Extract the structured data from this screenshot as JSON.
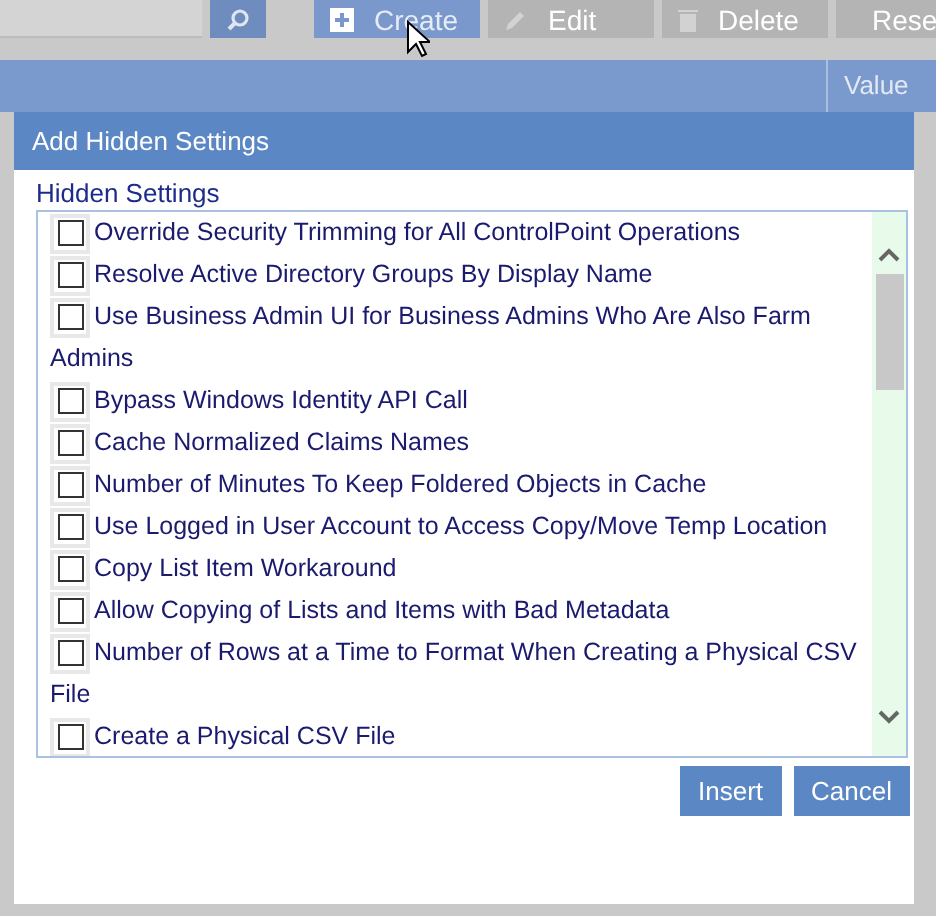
{
  "toolbar": {
    "buttons": [
      {
        "kind": "create",
        "label": "Create",
        "disabled": false
      },
      {
        "kind": "edit",
        "label": "Edit",
        "disabled": true
      },
      {
        "kind": "delete",
        "label": "Delete",
        "disabled": true
      },
      {
        "kind": "reset",
        "label": "Rese",
        "disabled": true
      }
    ]
  },
  "table": {
    "columns": [
      "Value"
    ]
  },
  "dialog": {
    "title": "Add Hidden Settings",
    "list_label": "Hidden Settings",
    "settings": [
      {
        "label": "Override Security Trimming for All ControlPoint Operations",
        "checked": false
      },
      {
        "label": "Resolve Active Directory Groups By Display Name",
        "checked": false
      },
      {
        "label": "Use Business Admin UI for Business Admins Who Are Also Farm Admins",
        "checked": false
      },
      {
        "label": "Bypass Windows Identity API Call",
        "checked": false
      },
      {
        "label": "Cache Normalized Claims Names",
        "checked": false
      },
      {
        "label": "Number of Minutes To Keep Foldered Objects in Cache",
        "checked": false
      },
      {
        "label": "Use Logged in User Account to Access Copy/Move Temp Location",
        "checked": false
      },
      {
        "label": "Copy List Item Workaround",
        "checked": false
      },
      {
        "label": "Allow Copying of Lists and Items with Bad Metadata",
        "checked": false
      },
      {
        "label": "Number of Rows at a Time to Format When Creating a Physical CSV File",
        "checked": false
      },
      {
        "label": "Create a Physical CSV File",
        "checked": false
      }
    ],
    "buttons": [
      "Insert",
      "Cancel"
    ]
  }
}
